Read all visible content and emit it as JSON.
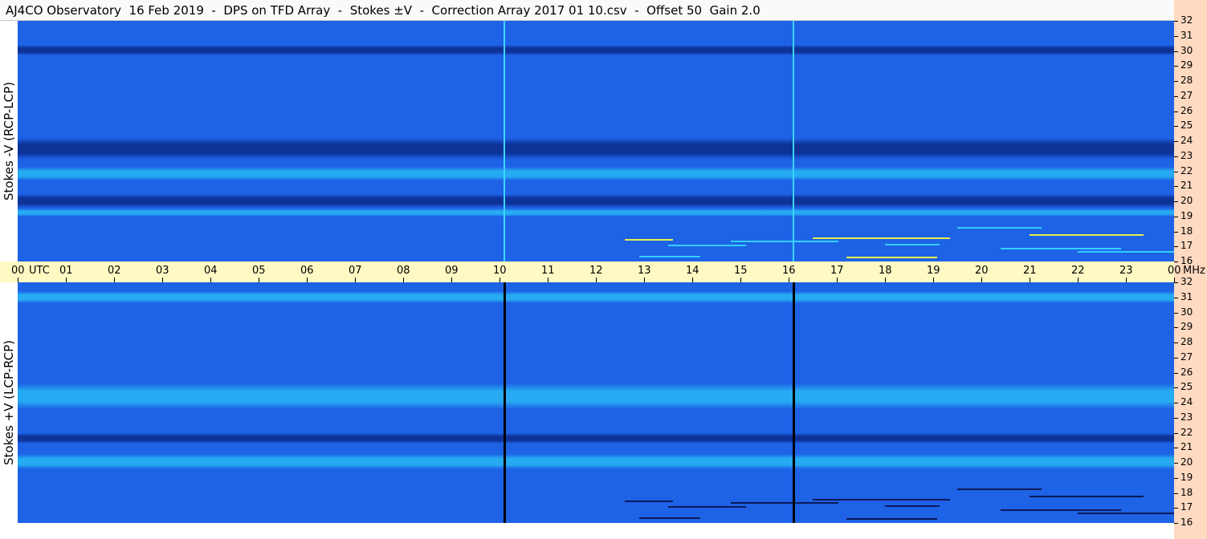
{
  "title": "AJ4CO Observatory  16 Feb 2019  -  DPS on TFD Array  -  Stokes ±V  -  Correction Array 2017 01 10.csv  -  Offset 50  Gain 2.0",
  "panels": {
    "top": {
      "ylabel": "Stokes -V (RCP-LCP)"
    },
    "bottom": {
      "ylabel": "Stokes +V (LCP-RCP)"
    }
  },
  "time_axis": {
    "labels": [
      "00",
      "UTC",
      "01",
      "02",
      "03",
      "04",
      "05",
      "06",
      "07",
      "08",
      "09",
      "10",
      "11",
      "12",
      "13",
      "14",
      "15",
      "16",
      "17",
      "18",
      "19",
      "20",
      "21",
      "22",
      "23",
      "00",
      "MHz"
    ]
  },
  "freq_axis": {
    "labels": [
      "32",
      "31",
      "30",
      "29",
      "28",
      "27",
      "26",
      "25",
      "24",
      "23",
      "22",
      "21",
      "20",
      "19",
      "18",
      "17",
      "16"
    ]
  },
  "colors": {
    "background_blue": "#1e62e6",
    "dark_band": "#0a2a8a",
    "light_band": "#27b8f5",
    "title_bg": "#fafafa",
    "time_bar_bg": "#fffac4",
    "right_strip_bg": "#ffd9c0"
  },
  "chart_data": {
    "type": "heatmap",
    "x_label": "UTC",
    "y_label": "MHz",
    "x_range": [
      0,
      24
    ],
    "y_range": [
      16,
      32
    ],
    "panels": [
      "Stokes -V (RCP-LCP)",
      "Stokes +V (LCP-RCP)"
    ],
    "vertical_lines_utc": [
      10.1,
      16.1
    ],
    "top_bands": [
      {
        "from_mhz": 29.7,
        "to_mhz": 30.4,
        "level": "dark"
      },
      {
        "from_mhz": 22.8,
        "to_mhz": 24.2,
        "level": "dark"
      },
      {
        "from_mhz": 21.4,
        "to_mhz": 22.3,
        "level": "light"
      },
      {
        "from_mhz": 19.6,
        "to_mhz": 20.5,
        "level": "dark"
      },
      {
        "from_mhz": 19.0,
        "to_mhz": 19.5,
        "level": "light"
      }
    ],
    "bottom_bands": [
      {
        "from_mhz": 30.6,
        "to_mhz": 31.4,
        "level": "light"
      },
      {
        "from_mhz": 23.6,
        "to_mhz": 25.3,
        "level": "light"
      },
      {
        "from_mhz": 21.3,
        "to_mhz": 22.0,
        "level": "dark"
      },
      {
        "from_mhz": 19.6,
        "to_mhz": 20.6,
        "level": "light"
      }
    ]
  }
}
